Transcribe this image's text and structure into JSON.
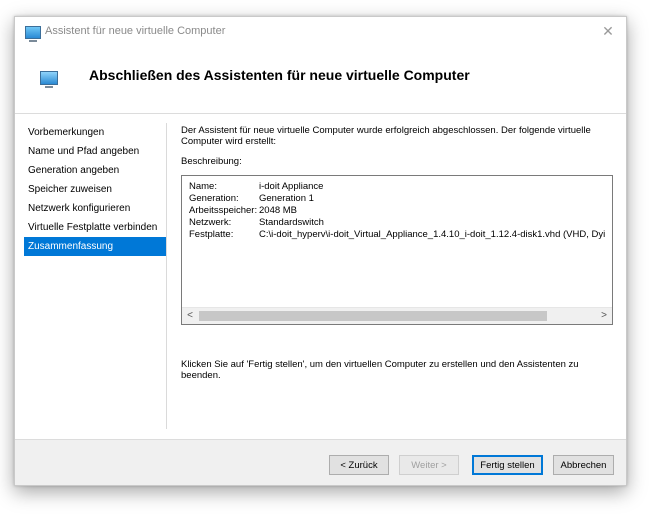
{
  "window": {
    "title": "Assistent für neue virtuelle Computer"
  },
  "header": {
    "title": "Abschließen des Assistenten für neue virtuelle Computer"
  },
  "nav": {
    "items": [
      {
        "label": "Vorbemerkungen"
      },
      {
        "label": "Name und Pfad angeben"
      },
      {
        "label": "Generation angeben"
      },
      {
        "label": "Speicher zuweisen"
      },
      {
        "label": "Netzwerk konfigurieren"
      },
      {
        "label": "Virtuelle Festplatte verbinden"
      },
      {
        "label": "Zusammenfassung"
      }
    ],
    "active": "Zusammenfassung"
  },
  "content": {
    "intro": "Der Assistent für neue virtuelle Computer wurde erfolgreich abgeschlossen. Der folgende virtuelle Computer wird erstellt:",
    "description_label": "Beschreibung:",
    "description": [
      {
        "key": "Name:",
        "value": "i-doit Appliance"
      },
      {
        "key": "Generation:",
        "value": "Generation 1"
      },
      {
        "key": "Arbeitsspeicher:",
        "value": "2048 MB"
      },
      {
        "key": "Netzwerk:",
        "value": "Standardswitch"
      },
      {
        "key": "Festplatte:",
        "value": "C:\\i-doit_hyperv\\i-doit_Virtual_Appliance_1.4.10_i-doit_1.12.4-disk1.vhd (VHD, Dyi"
      }
    ],
    "outro": "Klicken Sie auf 'Fertig stellen', um den virtuellen Computer zu erstellen und den Assistenten zu beenden."
  },
  "buttons": {
    "back": "< Zurück",
    "next": "Weiter >",
    "finish": "Fertig stellen",
    "cancel": "Abbrechen"
  },
  "icons": {
    "app": "virtual-machine-icon",
    "close": "close-icon",
    "scroll_left": "chevron-left-icon",
    "scroll_right": "chevron-right-icon"
  },
  "colors": {
    "accent": "#0078d7",
    "footer_bg": "#f0f0f0"
  }
}
